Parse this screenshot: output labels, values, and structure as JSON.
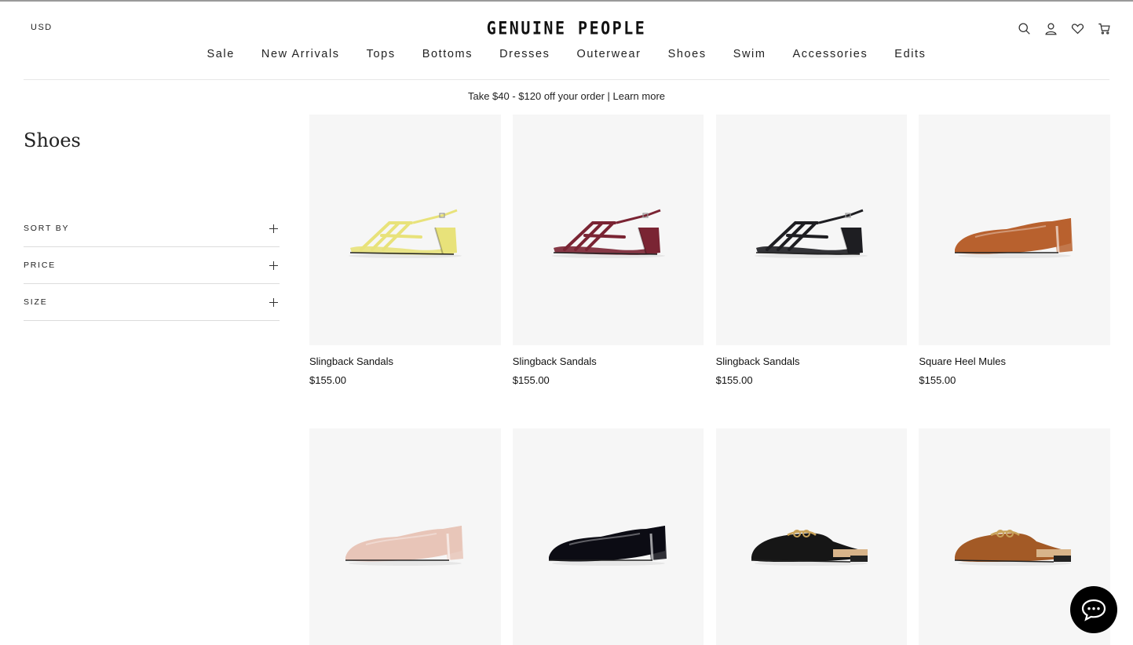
{
  "header": {
    "currency": "USD",
    "logo": "GENUINE PEOPLE",
    "icons": [
      "search-icon",
      "user-icon",
      "heart-icon",
      "cart-icon"
    ]
  },
  "nav": {
    "items": [
      "Sale",
      "New Arrivals",
      "Tops",
      "Bottoms",
      "Dresses",
      "Outerwear",
      "Shoes",
      "Swim",
      "Accessories",
      "Edits"
    ]
  },
  "promo": {
    "text": "Take $40 - $120 off your order",
    "separator": " | ",
    "link": "Learn more"
  },
  "sidebar": {
    "title": "Shoes",
    "filters": [
      "SORT BY",
      "PRICE",
      "SIZE"
    ]
  },
  "products": [
    {
      "name": "Slingback Sandals",
      "price": "$155.00",
      "color": "#e8e27a",
      "style": "sandal"
    },
    {
      "name": "Slingback Sandals",
      "price": "$155.00",
      "color": "#7a2433",
      "style": "sandal"
    },
    {
      "name": "Slingback Sandals",
      "price": "$155.00",
      "color": "#1e1e22",
      "style": "sandal"
    },
    {
      "name": "Square Heel Mules",
      "price": "$155.00",
      "color": "#b8612e",
      "style": "mule"
    },
    {
      "name": "",
      "price": "",
      "color": "#e8c5b8",
      "style": "mule"
    },
    {
      "name": "",
      "price": "",
      "color": "#0c0c14",
      "style": "mule"
    },
    {
      "name": "",
      "price": "",
      "color": "#161616",
      "style": "loafer"
    },
    {
      "name": "",
      "price": "",
      "color": "#a35a26",
      "style": "loafer"
    }
  ],
  "chat": {
    "icon": "chat-bubble-icon"
  }
}
